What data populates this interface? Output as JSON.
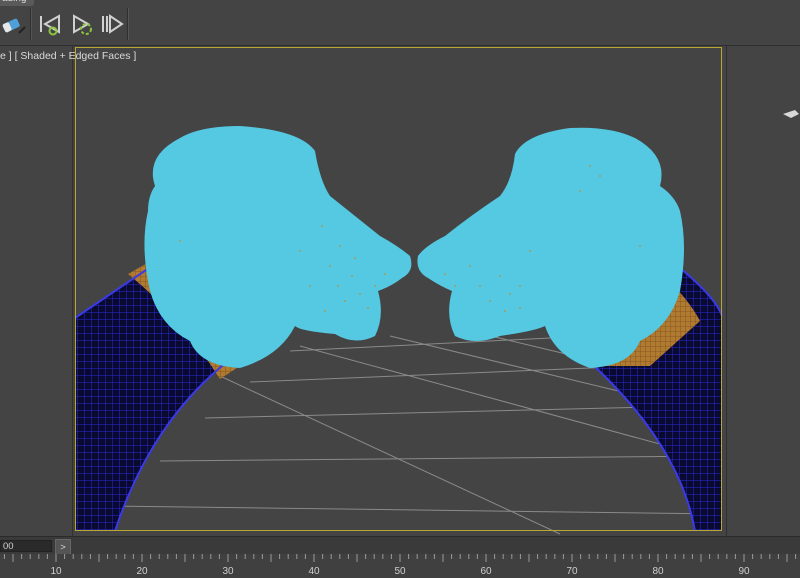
{
  "toolbar": {
    "tab_label": "ading",
    "buttons": [
      {
        "name": "eraser-tool",
        "icon": "eraser-icon"
      },
      {
        "name": "go-to-start",
        "icon": "skip-start-icon"
      },
      {
        "name": "play-selected",
        "icon": "play-loop-icon"
      },
      {
        "name": "next-key",
        "icon": "next-key-icon"
      }
    ]
  },
  "viewport": {
    "label": "e ] [ Shaded + Edged Faces ]",
    "frame_color": "#b8a832",
    "head_color": "#55c8e2",
    "tube_color": "#2222a8",
    "collar_color": "#c08a3c"
  },
  "timeline": {
    "frame_value": "00",
    "next_label": ">",
    "ruler_ticks": [
      "10",
      "20",
      "30",
      "40",
      "50",
      "60",
      "70",
      "80",
      "90"
    ]
  }
}
